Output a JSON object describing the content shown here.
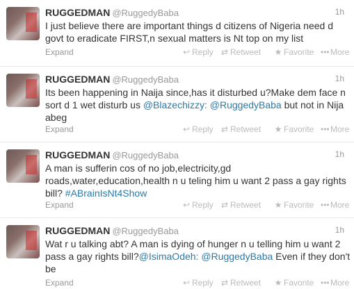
{
  "tweets": [
    {
      "name": "RUGGEDMAN",
      "handle": "@RuggedyBaba",
      "time": "1h",
      "text_parts": [
        {
          "type": "text",
          "value": "I just believe there are important things d citizens of Nigeria need d govt to eradicate FIRST,n sexual matters is Nt top on my list"
        }
      ]
    },
    {
      "name": "RUGGEDMAN",
      "handle": "@RuggedyBaba",
      "time": "1h",
      "text_parts": [
        {
          "type": "text",
          "value": "Its been happening in Naija since,has it disturbed u?Make dem face n sort d 1 wet disturb us "
        },
        {
          "type": "mention",
          "value": "@Blazechizzy:"
        },
        {
          "type": "text",
          "value": " "
        },
        {
          "type": "mention",
          "value": "@RuggedyBaba"
        },
        {
          "type": "text",
          "value": " but not in Nija abeg"
        }
      ]
    },
    {
      "name": "RUGGEDMAN",
      "handle": "@RuggedyBaba",
      "time": "1h",
      "text_parts": [
        {
          "type": "text",
          "value": "A man is sufferin cos of no job,electricity,gd roads,water,education,health n u teling him u want 2 pass a gay rights bill? "
        },
        {
          "type": "hashtag",
          "value": "#ABrainIsNt4Show"
        }
      ]
    },
    {
      "name": "RUGGEDMAN",
      "handle": "@RuggedyBaba",
      "time": "1h",
      "text_parts": [
        {
          "type": "text",
          "value": "Wat r u talking abt? A man is dying of hunger n u telling him u want 2 pass a gay rights bill?"
        },
        {
          "type": "mention",
          "value": "@IsimaOdeh:"
        },
        {
          "type": "text",
          "value": " "
        },
        {
          "type": "mention",
          "value": "@RuggedyBaba"
        },
        {
          "type": "text",
          "value": " Even if they don't be"
        }
      ]
    }
  ],
  "actions": {
    "expand": "Expand",
    "reply": "Reply",
    "retweet": "Retweet",
    "favorite": "Favorite",
    "more": "More"
  },
  "icons": {
    "reply": "reply-arrow-icon",
    "retweet": "retweet-icon",
    "favorite": "star-icon",
    "more": "ellipsis-icon"
  },
  "colors": {
    "link": "#2a7aa8",
    "muted": "#999999",
    "text": "#333333",
    "divider": "#e8e8e8"
  }
}
